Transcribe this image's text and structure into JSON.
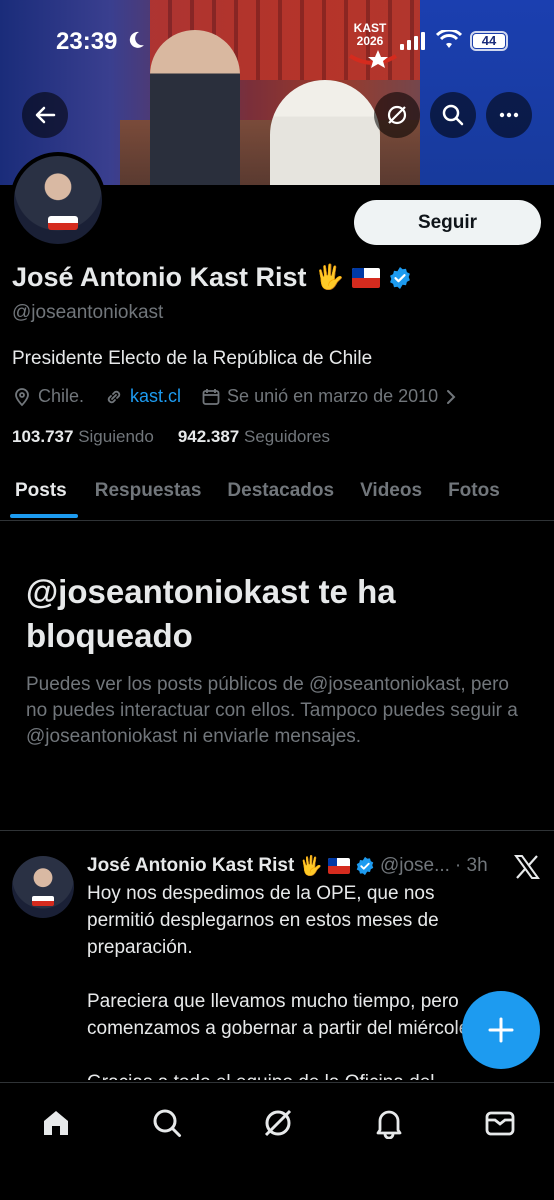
{
  "status_bar": {
    "time": "23:39",
    "battery": "44",
    "banner_logo_text": "KAST\n2026"
  },
  "banner_buttons": [
    {
      "icon": "back-arrow-icon"
    },
    {
      "icon": "grok-icon"
    },
    {
      "icon": "search-icon"
    },
    {
      "icon": "more-icon"
    }
  ],
  "profile": {
    "follow_label": "Seguir",
    "name": "José Antonio Kast Rist",
    "name_emoji": "🖐",
    "handle": "@joseantoniokast",
    "bio": "Presidente Electo de la República de Chile",
    "location": "Chile.",
    "website": "kast.cl",
    "joined": "Se unió en marzo de 2010",
    "following_count": "103.737",
    "following_label": "Siguiendo",
    "followers_count": "942.387",
    "followers_label": "Seguidores"
  },
  "tabs": [
    "Posts",
    "Respuestas",
    "Destacados",
    "Videos",
    "Fotos"
  ],
  "active_tab": "Posts",
  "blocked": {
    "title": "@joseantoniokast te ha bloqueado",
    "message": "Puedes ver los posts públicos de @joseantoniokast, pero no puedes interactuar con ellos. Tampoco puedes seguir a @joseantoniokast ni enviarle mensajes."
  },
  "post": {
    "author": "José Antonio Kast Rist",
    "emoji": "🖐",
    "handle": "@jose...",
    "time": "· 3h",
    "text": "Hoy nos despedimos de la OPE, que nos permitió desplegarnos en estos meses de preparación.\n\nPareciera que llevamos mucho tiempo, pero comenzamos a gobernar a partir del miércoles.\n\nGracias a todo el equipo de la Oficina del"
  },
  "bottom_nav": [
    "home-icon",
    "search-icon",
    "grok-icon",
    "notifications-icon",
    "messages-icon"
  ],
  "colors": {
    "accent": "#1d9bf0",
    "background": "#000000",
    "text_primary": "#e7e9ea",
    "text_secondary": "#71767b"
  }
}
